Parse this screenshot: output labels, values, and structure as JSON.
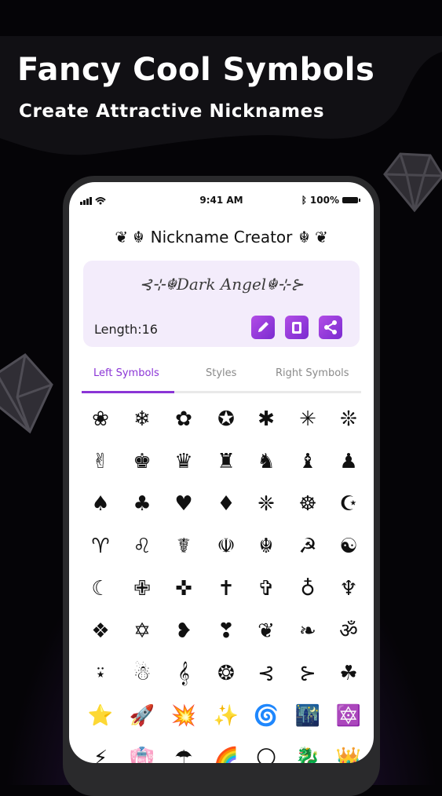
{
  "headline": "Fancy Cool Symbols",
  "subline": "Create Attractive Nicknames",
  "status": {
    "time": "9:41 AM",
    "battery": "100%"
  },
  "app": {
    "title": "Nickname Creator",
    "title_left_deco": "❦ ☬",
    "title_right_deco": "☬ ❦",
    "nickname": "⊰⊹☬Dark Angel☬⊹⊱",
    "length_label": "Length:16",
    "actions": [
      "edit",
      "copy",
      "share"
    ]
  },
  "tabs": [
    {
      "label": "Left Symbols",
      "active": true
    },
    {
      "label": "Styles",
      "active": false
    },
    {
      "label": "Right Symbols",
      "active": false
    }
  ],
  "symbols": [
    [
      "❀",
      "❄",
      "✿",
      "✪",
      "✱",
      "✳",
      "❊"
    ],
    [
      "✌",
      "♚",
      "♛",
      "♜",
      "♞",
      "♝",
      "♟"
    ],
    [
      "♠",
      "♣",
      "♥",
      "♦",
      "❈",
      "☸",
      "☪"
    ],
    [
      "♈",
      "♌",
      "☤",
      "☫",
      "☬",
      "☭",
      "☯"
    ],
    [
      "☾",
      "✙",
      "✜",
      "✝",
      "✞",
      "♁",
      "♆"
    ],
    [
      "❖",
      "✡",
      "❥",
      "❣",
      "❦",
      "❧",
      "ॐ"
    ],
    [
      "⍣",
      "☃",
      "𝄞",
      "❂",
      "⊰",
      "⊱",
      "☘"
    ],
    [
      "⭐",
      "🚀",
      "💥",
      "✨",
      "🌀",
      "🌃",
      "🔯"
    ],
    [
      "⚡",
      "👘",
      "☂",
      "🌈",
      "🌕",
      "🐉",
      "👑"
    ]
  ]
}
